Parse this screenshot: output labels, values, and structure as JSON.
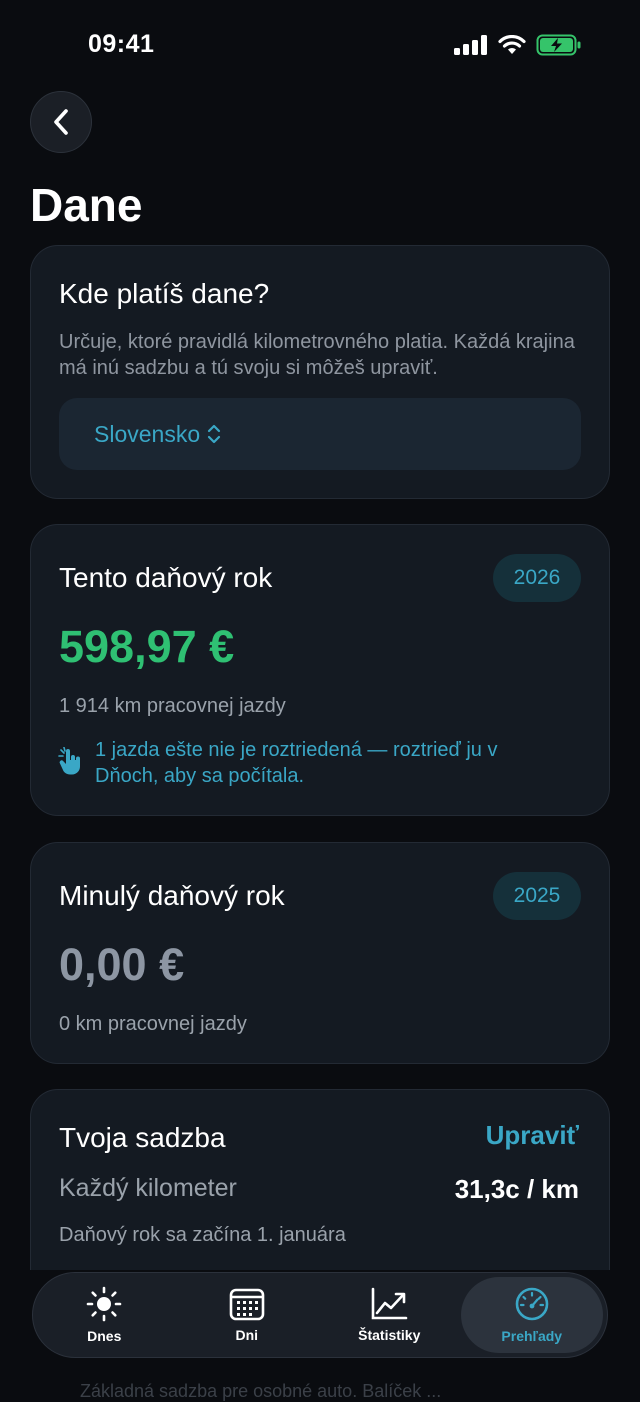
{
  "status_bar": {
    "time": "09:41"
  },
  "header": {
    "title": "Dane"
  },
  "country_card": {
    "title": "Kde platíš dane?",
    "description": "Určuje, ktoré pravidlá kilometrovného platia. Každá krajina má inú sadzbu a tú svoju si môžeš upraviť.",
    "selected_country": "Slovensko"
  },
  "current_year_card": {
    "title": "Tento daňový rok",
    "year": "2026",
    "amount": "598,97 €",
    "km_text": "1 914 km pracovnej jazdy",
    "hint": "1 jazda ešte nie je roztriedená — roztrieď ju v Dňoch, aby sa počítala."
  },
  "previous_year_card": {
    "title": "Minulý daňový rok",
    "year": "2025",
    "amount": "0,00 €",
    "km_text": "0 km pracovnej jazdy"
  },
  "rate_card": {
    "title": "Tvoja sadzba",
    "edit_label": "Upraviť",
    "rate_label": "Každý kilometer",
    "rate_value": "31,3c / km",
    "note": "Daňový rok sa začína 1. januára"
  },
  "behind_tabbar_text": "Základná sadzba pre osobné auto. Balíček ...",
  "tab_bar": {
    "tabs": [
      {
        "label": "Dnes",
        "icon": "sun-icon",
        "active": false
      },
      {
        "label": "Dni",
        "icon": "calendar-icon",
        "active": false
      },
      {
        "label": "Štatistiky",
        "icon": "chart-line-icon",
        "active": false
      },
      {
        "label": "Prehľady",
        "icon": "gauge-icon",
        "active": true
      }
    ]
  },
  "colors": {
    "background": "#0a0c10",
    "card": "#141a22",
    "accent": "#3aa7c6",
    "positive": "#2fc073",
    "muted": "#8d96a3"
  }
}
